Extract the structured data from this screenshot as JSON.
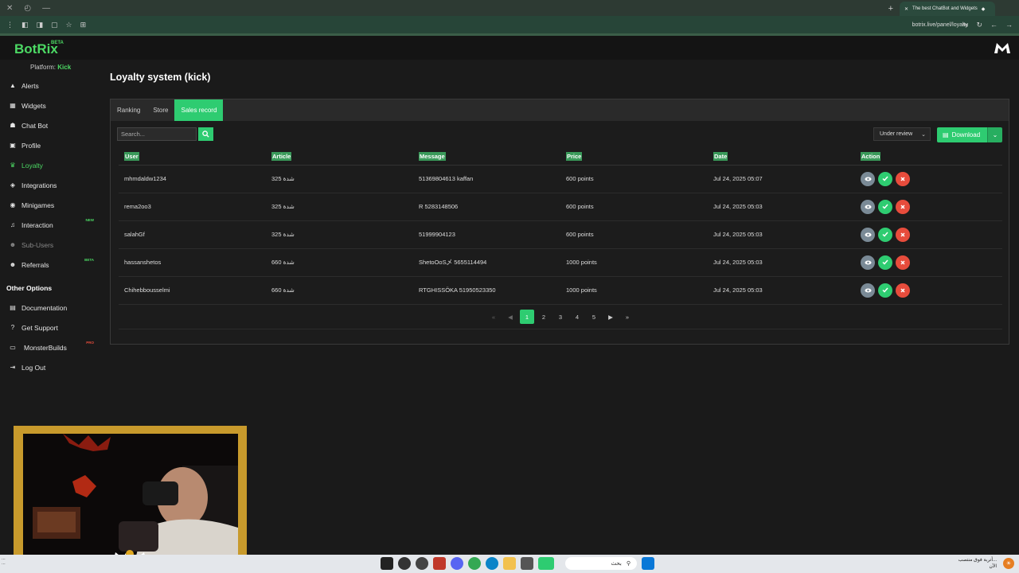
{
  "browser": {
    "tab_title": "The best ChatBot and Widgets",
    "url": "botrix.live/panel/loyalty"
  },
  "app": {
    "logo": "BotRix",
    "logo_badge": "BETA",
    "platform_label": "Platform:",
    "platform_value": "Kick"
  },
  "sidebar": {
    "items": [
      {
        "label": "Alerts",
        "icon": "warning-icon"
      },
      {
        "label": "Widgets",
        "icon": "grid-icon"
      },
      {
        "label": "Chat Bot",
        "icon": "chat-icon"
      },
      {
        "label": "Profile",
        "icon": "profile-card-icon"
      },
      {
        "label": "Loyalty",
        "icon": "trophy-icon",
        "active": true
      },
      {
        "label": "Integrations",
        "icon": "cube-icon"
      },
      {
        "label": "Minigames",
        "icon": "gamepad-icon"
      },
      {
        "label": "Interaction",
        "icon": "music-icon",
        "badge": "NEW"
      },
      {
        "label": "Sub-Users",
        "icon": "users-icon",
        "muted": true
      },
      {
        "label": "Referrals",
        "icon": "users-icon",
        "badge": "BETA"
      }
    ],
    "other_heading": "Other Options",
    "other_items": [
      {
        "label": "Documentation",
        "icon": "book-icon"
      },
      {
        "label": "Get Support",
        "icon": "question-icon"
      },
      {
        "label": "MonsterBuilds",
        "icon": "monitor-icon",
        "badge": "PRO"
      },
      {
        "label": "Log Out",
        "icon": "logout-icon"
      }
    ]
  },
  "page": {
    "title": "Loyalty system (kick)"
  },
  "tabs": [
    {
      "label": "Ranking"
    },
    {
      "label": "Store"
    },
    {
      "label": "Sales record",
      "active": true
    }
  ],
  "toolbar": {
    "search_placeholder": "Search...",
    "status_selected": "Under review",
    "download_label": "Download"
  },
  "table": {
    "columns": [
      "User",
      "Article",
      "Message",
      "Price",
      "Date",
      "Action"
    ],
    "rows": [
      {
        "user": "mhmdaldw1234",
        "article": "325 شدة",
        "message": "51369804613 kaffan",
        "price": "600 points",
        "date": "Jul 24, 2025 05:07"
      },
      {
        "user": "rema2oo3",
        "article": "325 شدة",
        "message": "R 5283148506",
        "price": "600 points",
        "date": "Jul 24, 2025 05:03"
      },
      {
        "user": "salahGf",
        "article": "325 شدة",
        "message": "51999904123",
        "price": "600 points",
        "date": "Jul 24, 2025 05:03"
      },
      {
        "user": "hassanshetos",
        "article": "660 شدة",
        "message": "ShetoOoS乄 5655114494",
        "price": "1000 points",
        "date": "Jul 24, 2025 05:03"
      },
      {
        "user": "Chihebbousselmi",
        "article": "660 شدة",
        "message": "RTGHISSÖKA 51950523350",
        "price": "1000 points",
        "date": "Jul 24, 2025 05:03"
      }
    ]
  },
  "pagination": {
    "pages": [
      "1",
      "2",
      "3",
      "4",
      "5"
    ],
    "current": "1"
  },
  "taskbar": {
    "search_text": "بحث",
    "weather_text": "أتربة فوق منتصب...",
    "weather_sub": "الآن"
  },
  "colors": {
    "accent": "#2ecc71",
    "danger": "#e74c3c",
    "view": "#7a8a96"
  }
}
